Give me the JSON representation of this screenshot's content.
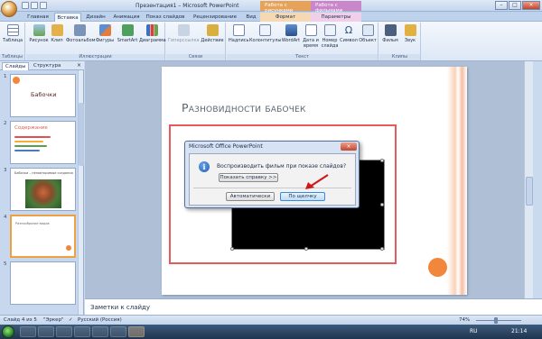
{
  "window": {
    "title": "Презентация1 – Microsoft PowerPoint",
    "ctx_pic": "Работа с рисунками",
    "ctx_vid": "Работа с фильмами"
  },
  "tabs": [
    "Главная",
    "Вставка",
    "Дизайн",
    "Анимация",
    "Показ слайдов",
    "Рецензирование",
    "Вид",
    "Формат",
    "Параметры"
  ],
  "ribbon": {
    "groups": [
      "Таблицы",
      "Иллюстрации",
      "Связи",
      "Текст",
      "Клипы мультимедиа"
    ],
    "buttons": [
      "Таблица",
      "Рисунок",
      "Клип",
      "Фотоальбом",
      "Фигуры",
      "SmartArt",
      "Диаграмма",
      "Гиперссылка",
      "Действие",
      "Надпись",
      "Колонтитулы",
      "WordArt",
      "Дата и время",
      "Номер слайда",
      "Символ",
      "Объект",
      "Фильм",
      "Звук"
    ]
  },
  "pane": {
    "tab_slides": "Слайды",
    "tab_outline": "Структура",
    "close": "×",
    "thumbs": [
      {
        "num": "1",
        "title": "Бабочки"
      },
      {
        "num": "2",
        "title": "Содержание"
      },
      {
        "num": "3",
        "title": "Бабочки – неповторимые создания"
      },
      {
        "num": "4",
        "title": "Разнообразие видов"
      },
      {
        "num": "5",
        "title": ""
      }
    ]
  },
  "slide": {
    "title": "Разновидности бабочек"
  },
  "notes": {
    "placeholder": "Заметки к слайду"
  },
  "status": {
    "slide": "Слайд 4 из 5",
    "theme": "\"Эркер\"",
    "lang": "Русский (Россия)",
    "zoom": "74%"
  },
  "tray": {
    "lang": "RU",
    "time": "21:14"
  },
  "dialog": {
    "title": "Microsoft Office PowerPoint",
    "close": "×",
    "message": "Воспроизводить фильм при показе слайдов?",
    "help_btn": "Показать справку >>",
    "auto_btn": "Автоматически",
    "click_btn": "По щелчку"
  },
  "colors": {
    "accent": "#f2863a",
    "title_text": "#5b6472",
    "placeholder_border": "#e55a5a"
  }
}
